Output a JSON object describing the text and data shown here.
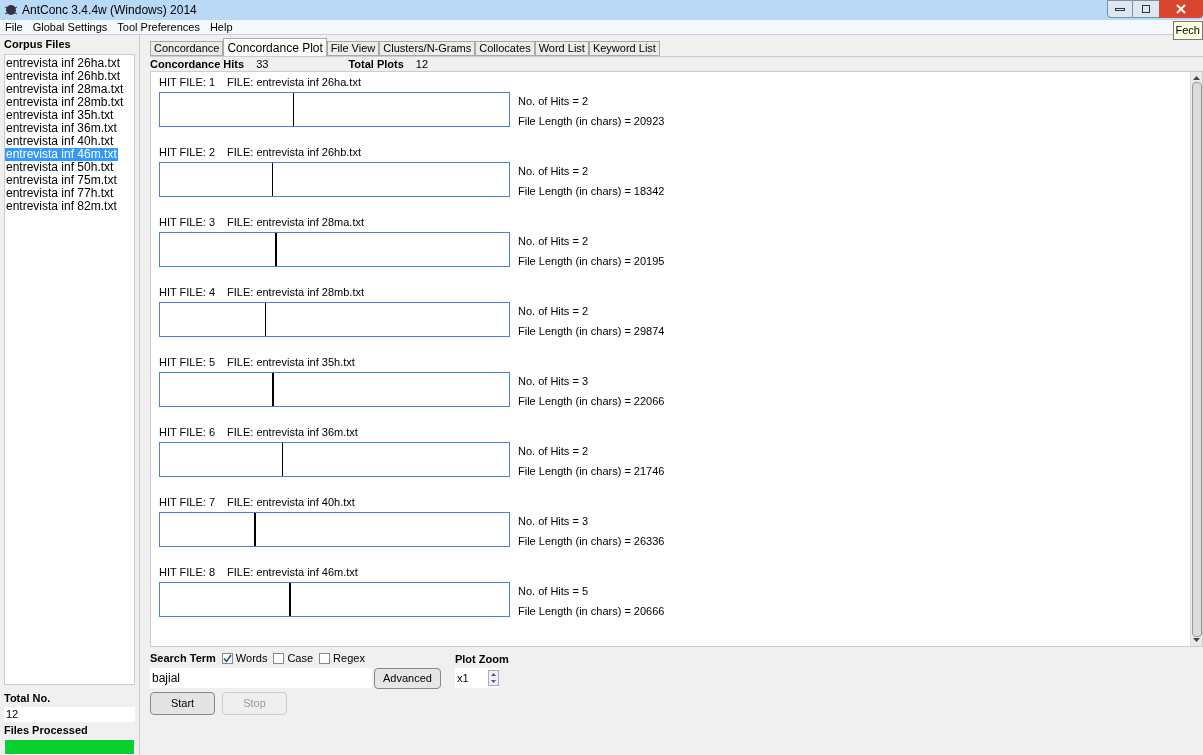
{
  "window": {
    "title": "AntConc 3.4.4w (Windows) 2014",
    "close_tooltip": "Fech"
  },
  "menu": [
    "File",
    "Global Settings",
    "Tool Preferences",
    "Help"
  ],
  "corpus_files": {
    "heading": "Corpus Files",
    "items": [
      {
        "label": "entrevista inf 26ha.txt",
        "selected": false
      },
      {
        "label": "entrevista inf 26hb.txt",
        "selected": false
      },
      {
        "label": "entrevista inf 28ma.txt",
        "selected": false
      },
      {
        "label": "entrevista inf 28mb.txt",
        "selected": false
      },
      {
        "label": "entrevista inf 35h.txt",
        "selected": false
      },
      {
        "label": "entrevista inf 36m.txt",
        "selected": false
      },
      {
        "label": "entrevista inf 40h.txt",
        "selected": false
      },
      {
        "label": "entrevista inf 46m.txt",
        "selected": true
      },
      {
        "label": "entrevista inf 50h.txt",
        "selected": false
      },
      {
        "label": "entrevista inf 75m.txt",
        "selected": false
      },
      {
        "label": "entrevista inf 77h.txt",
        "selected": false
      },
      {
        "label": "entrevista inf 82m.txt",
        "selected": false
      }
    ]
  },
  "totals": {
    "total_label": "Total No.",
    "total_value": "12",
    "processed_label": "Files Processed",
    "level": 1
  },
  "tabs": [
    {
      "label": "Concordance",
      "selected": false
    },
    {
      "label": "Concordance Plot",
      "selected": true
    },
    {
      "label": "File View",
      "selected": false
    },
    {
      "label": "Clusters/N-Grams",
      "selected": false
    },
    {
      "label": "Collocates",
      "selected": false
    },
    {
      "label": "Word List",
      "selected": false
    },
    {
      "label": "Keyword List",
      "selected": false
    }
  ],
  "summary": {
    "hits_label": "Concordance Hits",
    "hits": "33",
    "plots_label": "Total Plots",
    "plots": "12"
  },
  "plots": [
    {
      "hit_file": "HIT FILE: 1",
      "file": "FILE: entrevista inf 26ha.txt",
      "hits": "No. of Hits = 2",
      "length": "File Length (in chars) = 20923",
      "level": 0.38,
      "thick": false
    },
    {
      "hit_file": "HIT FILE: 2",
      "file": "FILE: entrevista inf 26hb.txt",
      "hits": "No. of Hits = 2",
      "length": "File Length (in chars) = 18342",
      "level": 0.32,
      "thick": false
    },
    {
      "hit_file": "HIT FILE: 3",
      "file": "FILE: entrevista inf 28ma.txt",
      "hits": "No. of Hits = 2",
      "length": "File Length (in chars) = 20195",
      "level": 0.33,
      "thick": true
    },
    {
      "hit_file": "HIT FILE: 4",
      "file": "FILE: entrevista inf 28mb.txt",
      "hits": "No. of Hits = 2",
      "length": "File Length (in chars) = 29874",
      "level": 0.3,
      "thick": false
    },
    {
      "hit_file": "HIT FILE: 5",
      "file": "FILE: entrevista inf 35h.txt",
      "hits": "No. of Hits = 3",
      "length": "File Length (in chars) = 22066",
      "level": 0.32,
      "thick": true
    },
    {
      "hit_file": "HIT FILE: 6",
      "file": "FILE: entrevista inf 36m.txt",
      "hits": "No. of Hits = 2",
      "length": "File Length (in chars) = 21746",
      "level": 0.35,
      "thick": false
    },
    {
      "hit_file": "HIT FILE: 7",
      "file": "FILE: entrevista inf 40h.txt",
      "hits": "No. of Hits = 3",
      "length": "File Length (in chars) = 26336",
      "level": 0.27,
      "thick": true
    },
    {
      "hit_file": "HIT FILE: 8",
      "file": "FILE: entrevista inf 46m.txt",
      "hits": "No. of Hits = 5",
      "length": "File Length (in chars) = 20666",
      "level": 0.37,
      "thick": true
    }
  ],
  "search": {
    "label": "Search Term",
    "options": [
      {
        "label": "Words",
        "checked": true
      },
      {
        "label": "Case",
        "checked": false
      },
      {
        "label": "Regex",
        "checked": false
      }
    ],
    "value": "bajial",
    "advanced": "Advanced",
    "zoom_label": "Plot Zoom",
    "zoom": "x1",
    "start": "Start",
    "stop": "Stop",
    "stop_disabled": true
  }
}
